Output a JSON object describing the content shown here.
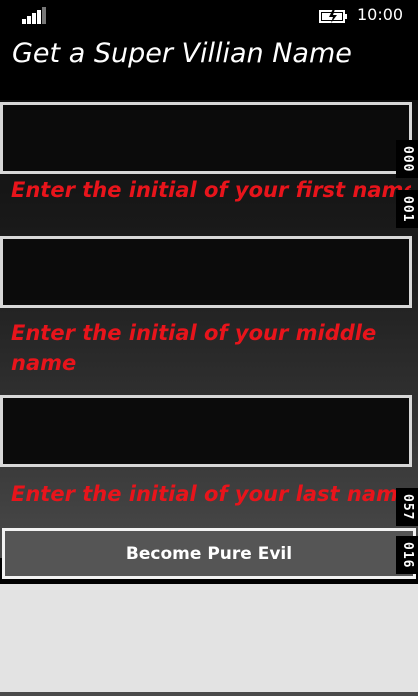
{
  "status_bar": {
    "time": "10:00",
    "signal_icon": "signal-strength-icon",
    "battery_icon": "battery-charging-icon"
  },
  "page": {
    "title": "Get a Super Villian Name"
  },
  "form": {
    "first_initial": {
      "value": "",
      "prompt": "Enter the initial of your first name"
    },
    "middle_initial": {
      "value": "",
      "prompt": "Enter the initial of your middle name"
    },
    "last_initial": {
      "value": "",
      "prompt": "Enter the initial of your last name"
    },
    "submit_label": "Become Pure Evil"
  },
  "frame_counters": {
    "top_a": "000",
    "top_b": "001",
    "bottom_a": "057",
    "bottom_b": "016"
  },
  "colors": {
    "prompt_text": "#e8141b",
    "background": "#000000",
    "button_bg": "#555555"
  }
}
